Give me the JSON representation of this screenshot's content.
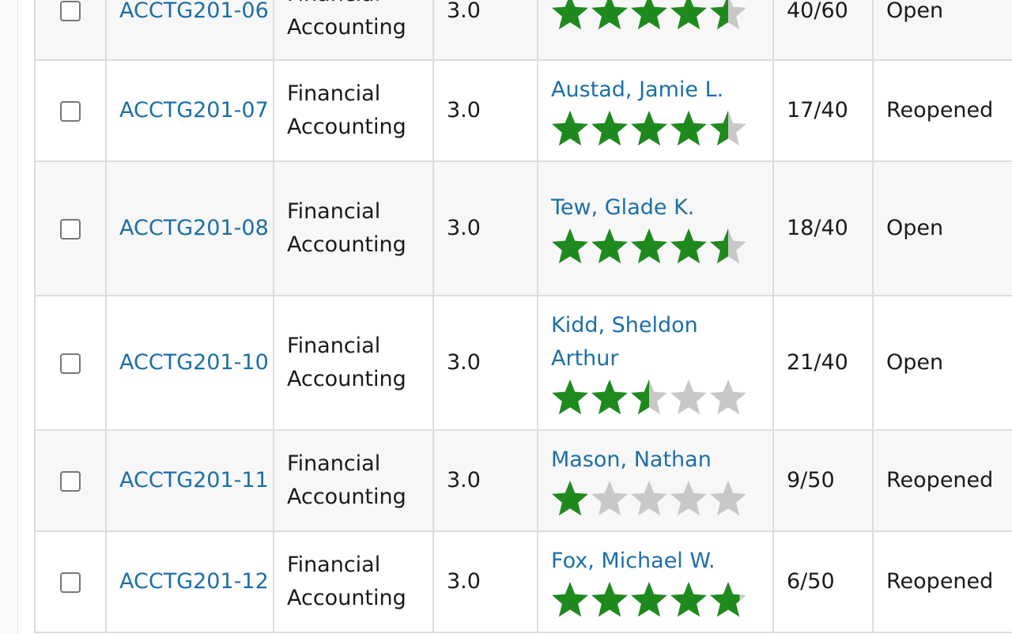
{
  "colors": {
    "link": "#1b6fa8",
    "star_filled": "#1e8a1e",
    "star_empty": "#c8c8c8",
    "row_odd": "#f7f7f7",
    "row_even": "#ffffff",
    "border": "#dddddd"
  },
  "icons": {
    "checkbox": "checkbox-icon",
    "star": "star-icon"
  },
  "sections": [
    {
      "section_id": "ACCTG201-06",
      "title_line1": "Financial",
      "title_line2": "Accounting",
      "credits": "3.0",
      "instructor": "",
      "rating": 4.5,
      "seats": "40/60",
      "status": "Open"
    },
    {
      "section_id": "ACCTG201-07",
      "title_line1": "Financial",
      "title_line2": "Accounting",
      "credits": "3.0",
      "instructor": "Austad, Jamie L.",
      "rating": 4.5,
      "seats": "17/40",
      "status": "Reopened"
    },
    {
      "section_id": "ACCTG201-08",
      "title_line1": "Financial",
      "title_line2": "Accounting",
      "credits": "3.0",
      "instructor": "Tew, Glade K.",
      "rating": 4.5,
      "seats": "18/40",
      "status": "Open"
    },
    {
      "section_id": "ACCTG201-10",
      "title_line1": "Financial",
      "title_line2": "Accounting",
      "credits": "3.0",
      "instructor": "Kidd, Sheldon Arthur",
      "rating": 2.5,
      "seats": "21/40",
      "status": "Open"
    },
    {
      "section_id": "ACCTG201-11",
      "title_line1": "Financial",
      "title_line2": "Accounting",
      "credits": "3.0",
      "instructor": "Mason, Nathan",
      "rating": 1,
      "seats": "9/50",
      "status": "Reopened"
    },
    {
      "section_id": "ACCTG201-12",
      "title_line1": "Financial",
      "title_line2": "Accounting",
      "credits": "3.0",
      "instructor": "Fox, Michael W.",
      "rating": 4.8,
      "seats": "6/50",
      "status": "Reopened"
    }
  ]
}
